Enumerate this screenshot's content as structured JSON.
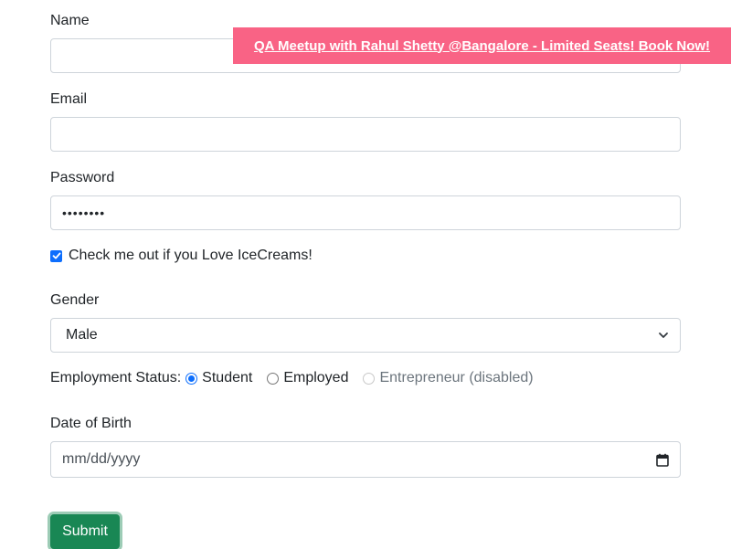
{
  "form": {
    "name_label": "Name",
    "name_value": "",
    "email_label": "Email",
    "email_value": "",
    "password_label": "Password",
    "password_value": "••••••••",
    "checkbox_label": "Check me out if you Love IceCreams!",
    "checkbox_checked": true,
    "gender_label": "Gender",
    "gender_selected": "Male",
    "employment_label": "Employment Status:",
    "employment_options": [
      {
        "label": "Student",
        "checked": true,
        "disabled": false
      },
      {
        "label": "Employed",
        "checked": false,
        "disabled": false
      },
      {
        "label": "Entrepreneur (disabled)",
        "checked": false,
        "disabled": true
      }
    ],
    "dob_label": "Date of Birth",
    "dob_placeholder": "mm/dd/yyyy",
    "submit_label": "Submit"
  },
  "banner": {
    "text": "QA Meetup with Rahul Shetty @Bangalore - Limited Seats! Book Now!",
    "color": "#f96385"
  },
  "colors": {
    "primary": "#0d6efd",
    "success": "#198754"
  },
  "icons": {
    "select": "chevron-down-icon",
    "date": "calendar-icon",
    "checkbox": "check-icon"
  }
}
